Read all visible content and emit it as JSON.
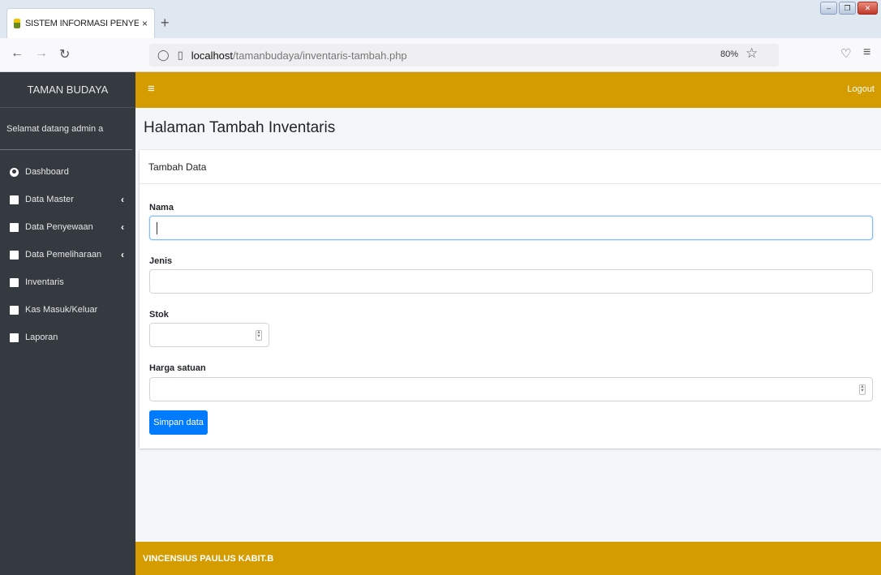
{
  "browser": {
    "tab_title": "SISTEM INFORMASI PENYEWA",
    "tab_close": "×",
    "new_tab": "+",
    "url_host": "localhost",
    "url_path": "/tamanbudaya/inventaris-tambah.php",
    "zoom": "80%"
  },
  "sidebar": {
    "brand": "TAMAN BUDAYA",
    "welcome": "Selamat datang admin a",
    "items": [
      {
        "label": "Dashboard",
        "icon": "dashboard-icon",
        "has_chevron": false
      },
      {
        "label": "Data Master",
        "icon": "square-icon",
        "has_chevron": true
      },
      {
        "label": "Data Penyewaan",
        "icon": "square-icon",
        "has_chevron": true
      },
      {
        "label": "Data Pemeliharaan",
        "icon": "square-icon",
        "has_chevron": true
      },
      {
        "label": "Inventaris",
        "icon": "square-icon",
        "has_chevron": false
      },
      {
        "label": "Kas Masuk/Keluar",
        "icon": "square-icon",
        "has_chevron": false
      },
      {
        "label": "Laporan",
        "icon": "square-icon",
        "has_chevron": false
      }
    ],
    "chevron": "‹"
  },
  "topbar": {
    "menu_icon": "≡",
    "logout": "Logout"
  },
  "page": {
    "title": "Halaman Tambah Inventaris",
    "card_title": "Tambah Data",
    "fields": {
      "nama": {
        "label": "Nama",
        "value": ""
      },
      "jenis": {
        "label": "Jenis",
        "value": ""
      },
      "stok": {
        "label": "Stok",
        "value": ""
      },
      "harga": {
        "label": "Harga satuan",
        "value": ""
      }
    },
    "submit": "Simpan data"
  },
  "footer": {
    "text": "VINCENSIUS PAULUS KABIT.B"
  },
  "colors": {
    "accent": "#d49c00",
    "sidebar": "#343a40",
    "primary_button": "#007bff"
  }
}
